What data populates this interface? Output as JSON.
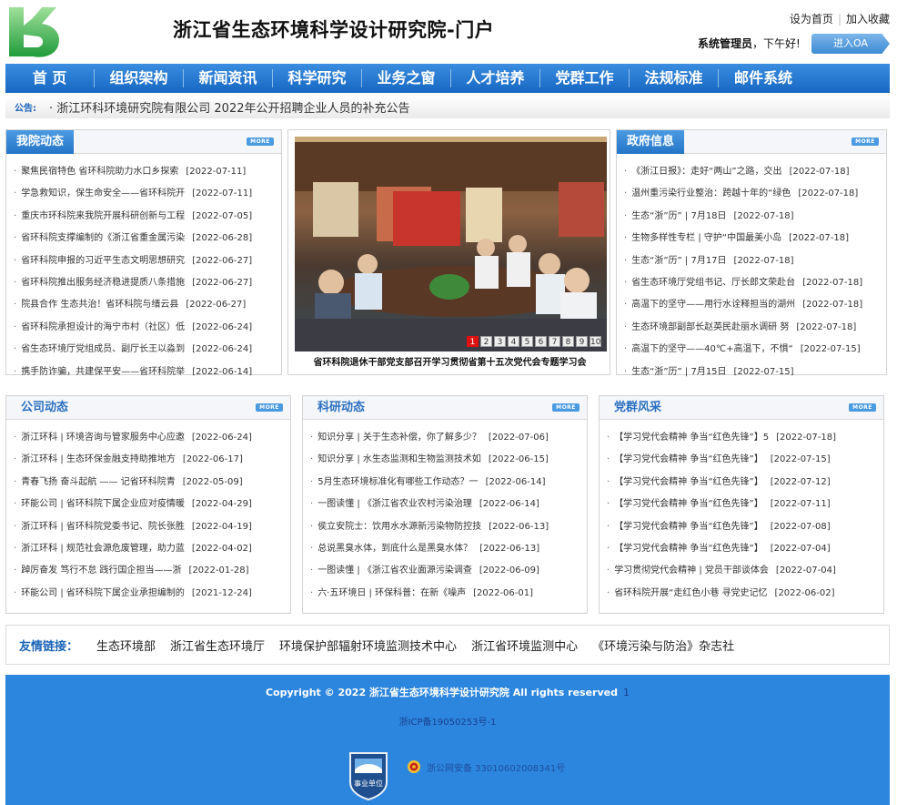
{
  "header": {
    "title": "浙江省生态环境科学设计研究院-门户",
    "set_home": "设为首页",
    "favorite": "加入收藏",
    "user": "系统管理员",
    "greeting": "下午好!",
    "oa_button": "进入OA"
  },
  "nav": [
    "首  页",
    "组织架构",
    "新闻资讯",
    "科学研究",
    "业务之窗",
    "人才培养",
    "党群工作",
    "法规标准",
    "邮件系统"
  ],
  "notice": {
    "label": "公告:",
    "text": "· 浙江环科环境研究院有限公司 2022年公开招聘企业人员的补充公告"
  },
  "more_label": "MORE",
  "panels": {
    "wyd": {
      "title": "我院动态",
      "items": [
        {
          "t": "聚焦民宿特色 省环科院助力水口乡探索",
          "d": "[2022-07-11]"
        },
        {
          "t": "学急救知识，保生命安全——省环科院开",
          "d": "[2022-07-11]"
        },
        {
          "t": "重庆市环科院来我院开展科研创新与工程",
          "d": "[2022-07-05]"
        },
        {
          "t": "省环科院支撑编制的《浙江省重金属污染",
          "d": "[2022-06-28]"
        },
        {
          "t": "省环科院申报的习近平生态文明思想研究",
          "d": "[2022-06-27]"
        },
        {
          "t": "省环科院推出服务经济稳进提质八条措施",
          "d": "[2022-06-27]"
        },
        {
          "t": "院县合作 生态共治！省环科院与缙云县",
          "d": "[2022-06-27]"
        },
        {
          "t": "省环科院承担设计的海宁市村（社区）低",
          "d": "[2022-06-24]"
        },
        {
          "t": "省生态环境厅党组成员、副厅长王以淼到",
          "d": "[2022-06-24]"
        },
        {
          "t": "携手防诈骗，共建保平安——省环科院举",
          "d": "[2022-06-14]"
        }
      ]
    },
    "photo": {
      "caption": "省环科院退休干部党支部召开学习贯彻省第十五次党代会专题学习会",
      "pages": [
        "1",
        "2",
        "3",
        "4",
        "5",
        "6",
        "7",
        "8",
        "9",
        "10"
      ]
    },
    "zfxx": {
      "title": "政府信息",
      "items": [
        {
          "t": "《浙江日报》：走好“两山”之路，交出",
          "d": "[2022-07-18]"
        },
        {
          "t": "温州重污染行业整治：跨越十年的“绿色",
          "d": "[2022-07-18]"
        },
        {
          "t": "生态“浙”历” | 7月18日",
          "d": "[2022-07-18]"
        },
        {
          "t": "生物多样性专栏 | 守护“中国最美小岛",
          "d": "[2022-07-18]"
        },
        {
          "t": "生态“浙”历” | 7月17日",
          "d": "[2022-07-18]"
        },
        {
          "t": "省生态环境厅党组书记、厅长郎文荣赴台",
          "d": "[2022-07-18]"
        },
        {
          "t": "高温下的坚守——用行水诠释担当的湖州",
          "d": "[2022-07-18]"
        },
        {
          "t": "生态环境部副部长赵英民赴丽水调研 努",
          "d": "[2022-07-18]"
        },
        {
          "t": "高温下的坚守——40℃+高温下，不惧“",
          "d": "[2022-07-15]"
        },
        {
          "t": "生态“浙”历” | 7月15日",
          "d": "[2022-07-15]"
        }
      ]
    },
    "gsdt": {
      "title": "公司动态",
      "items": [
        {
          "t": "浙江环科 | 环境咨询与管家服务中心应邀",
          "d": "[2022-06-24]"
        },
        {
          "t": "浙江环科 | 生态环保金融支持助推地方",
          "d": "[2022-06-17]"
        },
        {
          "t": "青春飞扬 奋斗起航 —— 记省环科院青",
          "d": "[2022-05-09]"
        },
        {
          "t": "环能公司 | 省环科院下属企业应对疫情暖",
          "d": "[2022-04-29]"
        },
        {
          "t": "浙江环科 | 省环科院党委书记、院长张胜",
          "d": "[2022-04-19]"
        },
        {
          "t": "浙江环科 | 规范社会源危废管理，助力蓝",
          "d": "[2022-04-02]"
        },
        {
          "t": "踔厉奋发 笃行不怠 践行国企担当——浙",
          "d": "[2022-01-28]"
        },
        {
          "t": "环能公司 | 省环科院下属企业承担编制的",
          "d": "[2021-12-24]"
        }
      ]
    },
    "kydt": {
      "title": "科研动态",
      "items": [
        {
          "t": "知识分享 | 关于生态补偿，你了解多少？",
          "d": "[2022-07-06]"
        },
        {
          "t": "知识分享 | 水生态监测和生物监测技术如",
          "d": "[2022-06-15]"
        },
        {
          "t": "5月生态环境标准化有哪些工作动态？一",
          "d": "[2022-06-14]"
        },
        {
          "t": "一图读懂 | 《浙江省农业农村污染治理",
          "d": "[2022-06-14]"
        },
        {
          "t": "侯立安院士：饮用水水源新污染物防控技",
          "d": "[2022-06-13]"
        },
        {
          "t": "总说黑臭水体，到底什么是黑臭水体？",
          "d": "[2022-06-13]"
        },
        {
          "t": "一图读懂 | 《浙江省农业面源污染调查",
          "d": "[2022-06-09]"
        },
        {
          "t": "六·五环境日 | 环保科普：在新《噪声",
          "d": "[2022-06-01]"
        }
      ]
    },
    "dqfc": {
      "title": "党群风采",
      "items": [
        {
          "t": "【学习党代会精神 争当“红色先锋”】5",
          "d": "[2022-07-18]"
        },
        {
          "t": "【学习党代会精神 争当“红色先锋”】",
          "d": "[2022-07-15]"
        },
        {
          "t": "【学习党代会精神 争当“红色先锋”】",
          "d": "[2022-07-12]"
        },
        {
          "t": "【学习党代会精神 争当“红色先锋”】",
          "d": "[2022-07-11]"
        },
        {
          "t": "【学习党代会精神 争当“红色先锋”】",
          "d": "[2022-07-08]"
        },
        {
          "t": "【学习党代会精神 争当“红色先锋”】",
          "d": "[2022-07-04]"
        },
        {
          "t": "学习贯彻党代会精神 | 党员干部谈体会",
          "d": "[2022-07-04]"
        },
        {
          "t": "省环科院开展“走红色小巷 寻党史记忆",
          "d": "[2022-06-02]"
        }
      ]
    }
  },
  "friend_links": {
    "label": "友情链接：",
    "items": [
      "生态环境部",
      "浙江省生态环境厅",
      "环境保护部辐射环境监测技术中心",
      "浙江省环境监测中心",
      "《环境污染与防治》杂志社"
    ]
  },
  "footer": {
    "copyright": "Copyright © 2022 浙江省生态环境科学设计研究院 All rights reserved",
    "copyright_num": "1",
    "icp": "浙ICP备19050253号-1",
    "police": "浙公网安备 33010602008341号",
    "badge_text": "事业单位"
  },
  "colors": {
    "primary": "#2d86de",
    "nav_dark": "#1767c2",
    "accent_red": "#d11"
  }
}
